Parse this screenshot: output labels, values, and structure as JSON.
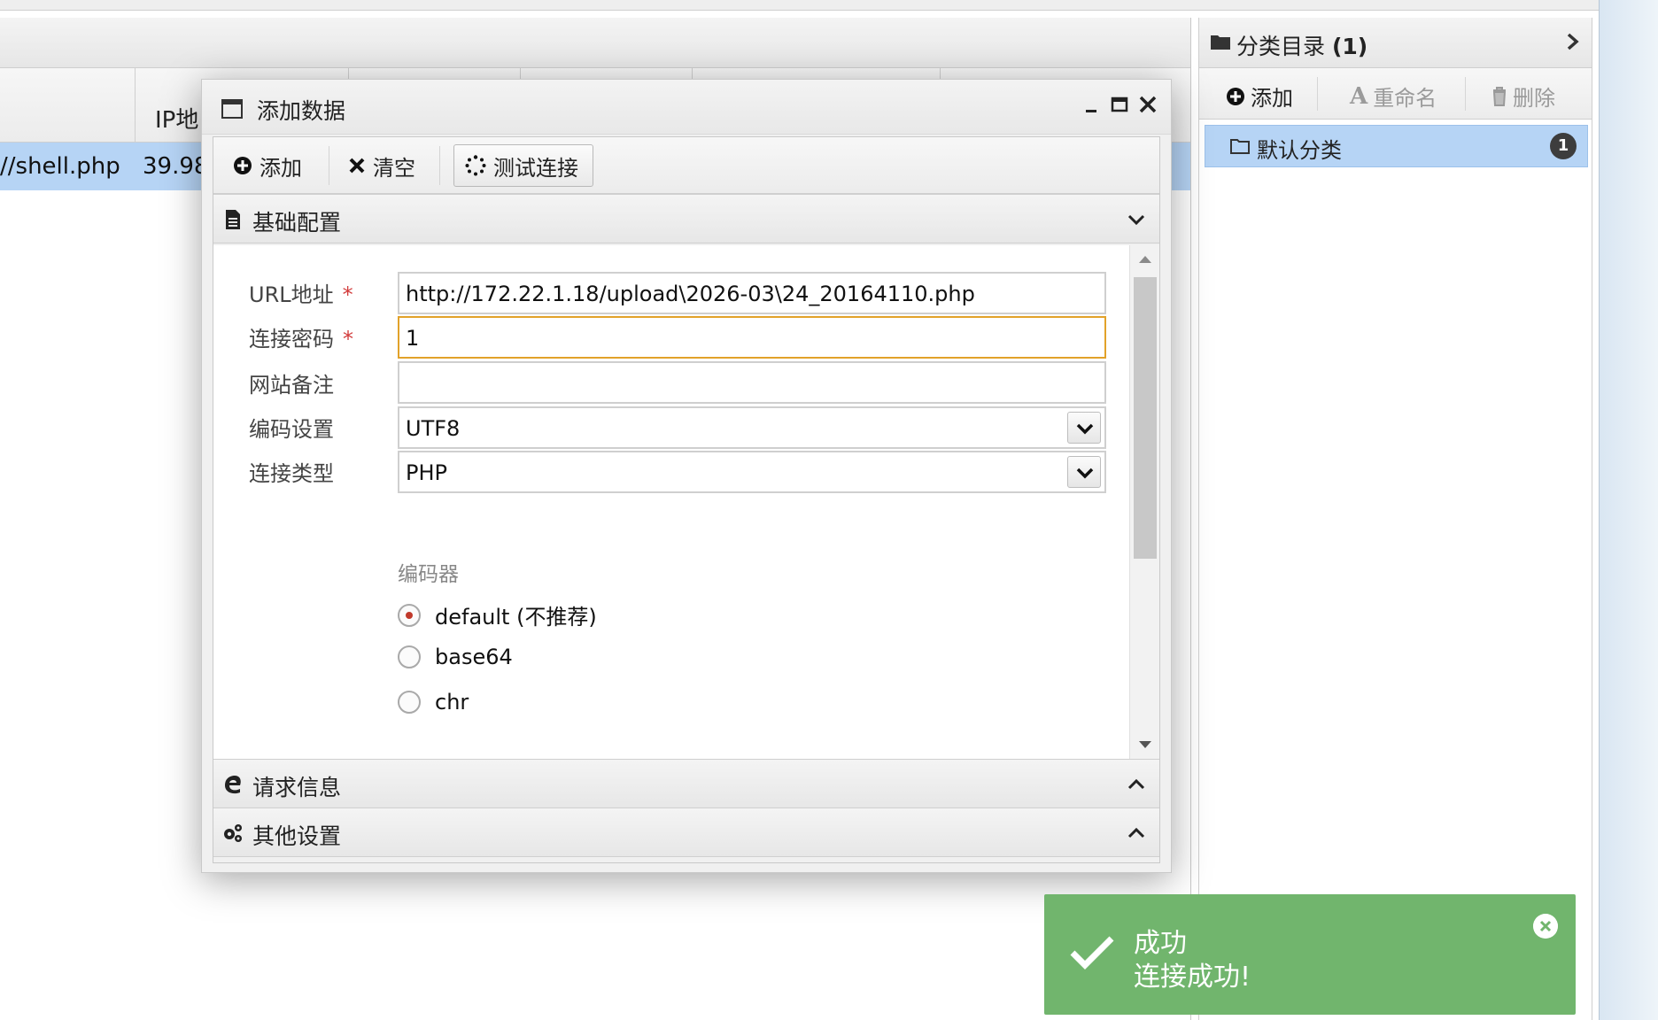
{
  "main_grid": {
    "col_header_ip": "IP地",
    "row_url": "//shell.php",
    "row_ip": "39.98"
  },
  "category_panel": {
    "title_prefix": "分类目录",
    "title_count": "(1)",
    "add_label": "添加",
    "rename_label": "重命名",
    "delete_label": "删除",
    "items": [
      {
        "label": "默认分类",
        "count": "1"
      }
    ]
  },
  "dialog": {
    "title": "添加数据",
    "toolbar": {
      "add_label": "添加",
      "clear_label": "清空",
      "test_label": "测试连接"
    },
    "sections": {
      "basic": "基础配置",
      "request": "请求信息",
      "other": "其他设置"
    },
    "form": {
      "url_label": "URL地址",
      "url_value": "http://172.22.1.18/upload\\2026-03\\24_20164110.php",
      "password_label": "连接密码",
      "password_value": "1",
      "note_label": "网站备注",
      "note_value": "",
      "encoding_label": "编码设置",
      "encoding_value": "UTF8",
      "type_label": "连接类型",
      "type_value": "PHP",
      "encoder_label": "编码器",
      "required_mark": "*",
      "encoders": [
        {
          "label": "default (不推荐)",
          "checked": true
        },
        {
          "label": "base64",
          "checked": false
        },
        {
          "label": "chr",
          "checked": false
        }
      ]
    }
  },
  "toast": {
    "title": "成功",
    "message": "连接成功!",
    "color": "#71b56d"
  },
  "colors": {
    "selection": "#b6d4f5",
    "focus_border": "#e2a22a",
    "required": "#d23c3c"
  }
}
